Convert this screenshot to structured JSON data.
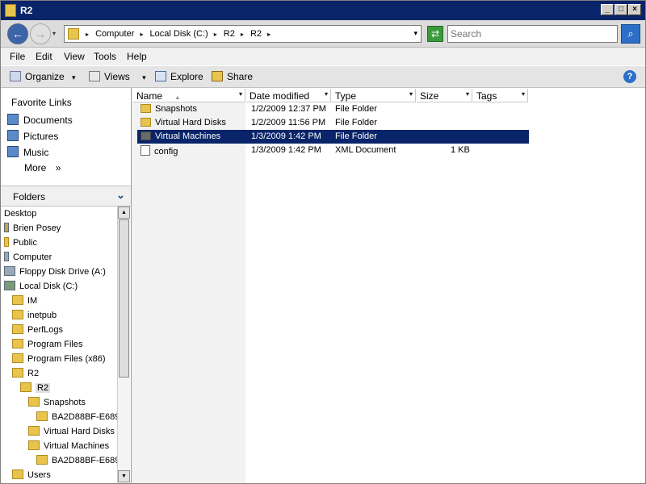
{
  "window": {
    "title": "R2"
  },
  "title_buttons": {
    "minimize": "_",
    "maximize": "□",
    "close": "×"
  },
  "nav": {
    "back_icon": "←",
    "forward_icon": "→",
    "dropdown_icon": "▾"
  },
  "address": {
    "crumbs": [
      "Computer",
      "Local Disk (C:)",
      "R2",
      "R2"
    ],
    "separator": "▸",
    "dropdown_icon": "▾"
  },
  "refresh_icon": "⇄",
  "search": {
    "placeholder": "Search",
    "icon": "⌕"
  },
  "menu": [
    "File",
    "Edit",
    "View",
    "Tools",
    "Help"
  ],
  "toolbar": {
    "organize": "Organize",
    "views": "Views",
    "explore": "Explore",
    "share": "Share",
    "dropdown_icon": "▾",
    "help_icon": "?"
  },
  "favorites": {
    "title": "Favorite Links",
    "items": [
      "Documents",
      "Pictures",
      "Music"
    ],
    "more": "More",
    "more_icon": "»"
  },
  "folders": {
    "title": "Folders",
    "collapse_icon": "⌄",
    "tree": [
      "Desktop",
      "Brien Posey",
      "Public",
      "Computer",
      "Floppy Disk Drive (A:)",
      "Local Disk (C:)",
      "IM",
      "inetpub",
      "PerfLogs",
      "Program Files",
      "Program Files (x86)",
      "R2",
      "R2",
      "Snapshots",
      "BA2D88BF-E689",
      "Virtual Hard Disks",
      "Virtual Machines",
      "BA2D88BF-E689",
      "Users"
    ]
  },
  "scroll": {
    "up_icon": "▲",
    "down_icon": "▼"
  },
  "columns": [
    "Name",
    "Date modified",
    "Type",
    "Size",
    "Tags"
  ],
  "sort_icon": "▲",
  "files": [
    {
      "name": "Snapshots",
      "date": "1/2/2009 12:37 PM",
      "type": "File Folder",
      "size": ""
    },
    {
      "name": "Virtual Hard Disks",
      "date": "1/2/2009 11:56 PM",
      "type": "File Folder",
      "size": ""
    },
    {
      "name": "Virtual Machines",
      "date": "1/3/2009 1:42 PM",
      "type": "File Folder",
      "size": ""
    },
    {
      "name": "config",
      "date": "1/3/2009 1:42 PM",
      "type": "XML Document",
      "size": "1 KB"
    }
  ],
  "colors": {
    "selection": "#0a246a",
    "folder": "#e8c44c"
  }
}
